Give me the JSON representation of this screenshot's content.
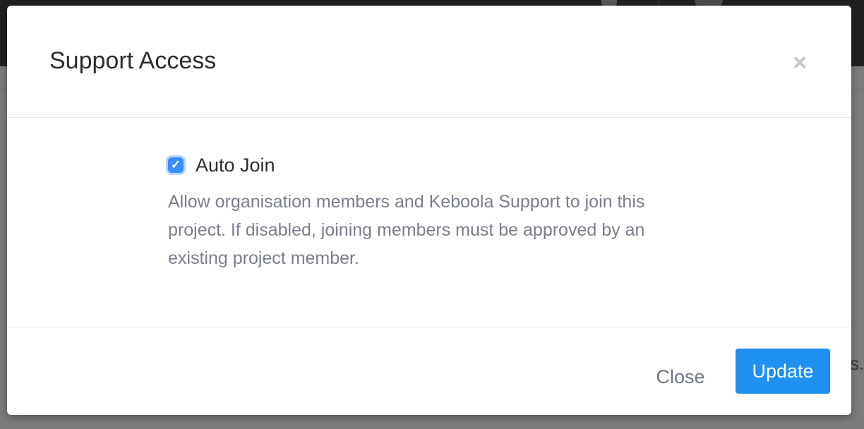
{
  "modal": {
    "title": "Support Access",
    "close_icon": "×",
    "checkbox": {
      "label": "Auto Join",
      "checked": true,
      "check_glyph": "✓"
    },
    "help_text": "Allow organisation members and Keboola Support to join this project. If disabled, joining members must be approved by an existing project member.",
    "buttons": {
      "close_label": "Close",
      "update_label": "Update"
    }
  },
  "background": {
    "fragment_text": "s."
  },
  "colors": {
    "primary": "#1f8ff0",
    "checkbox": "#3a8dfa",
    "muted_text": "#7b7f8c"
  }
}
